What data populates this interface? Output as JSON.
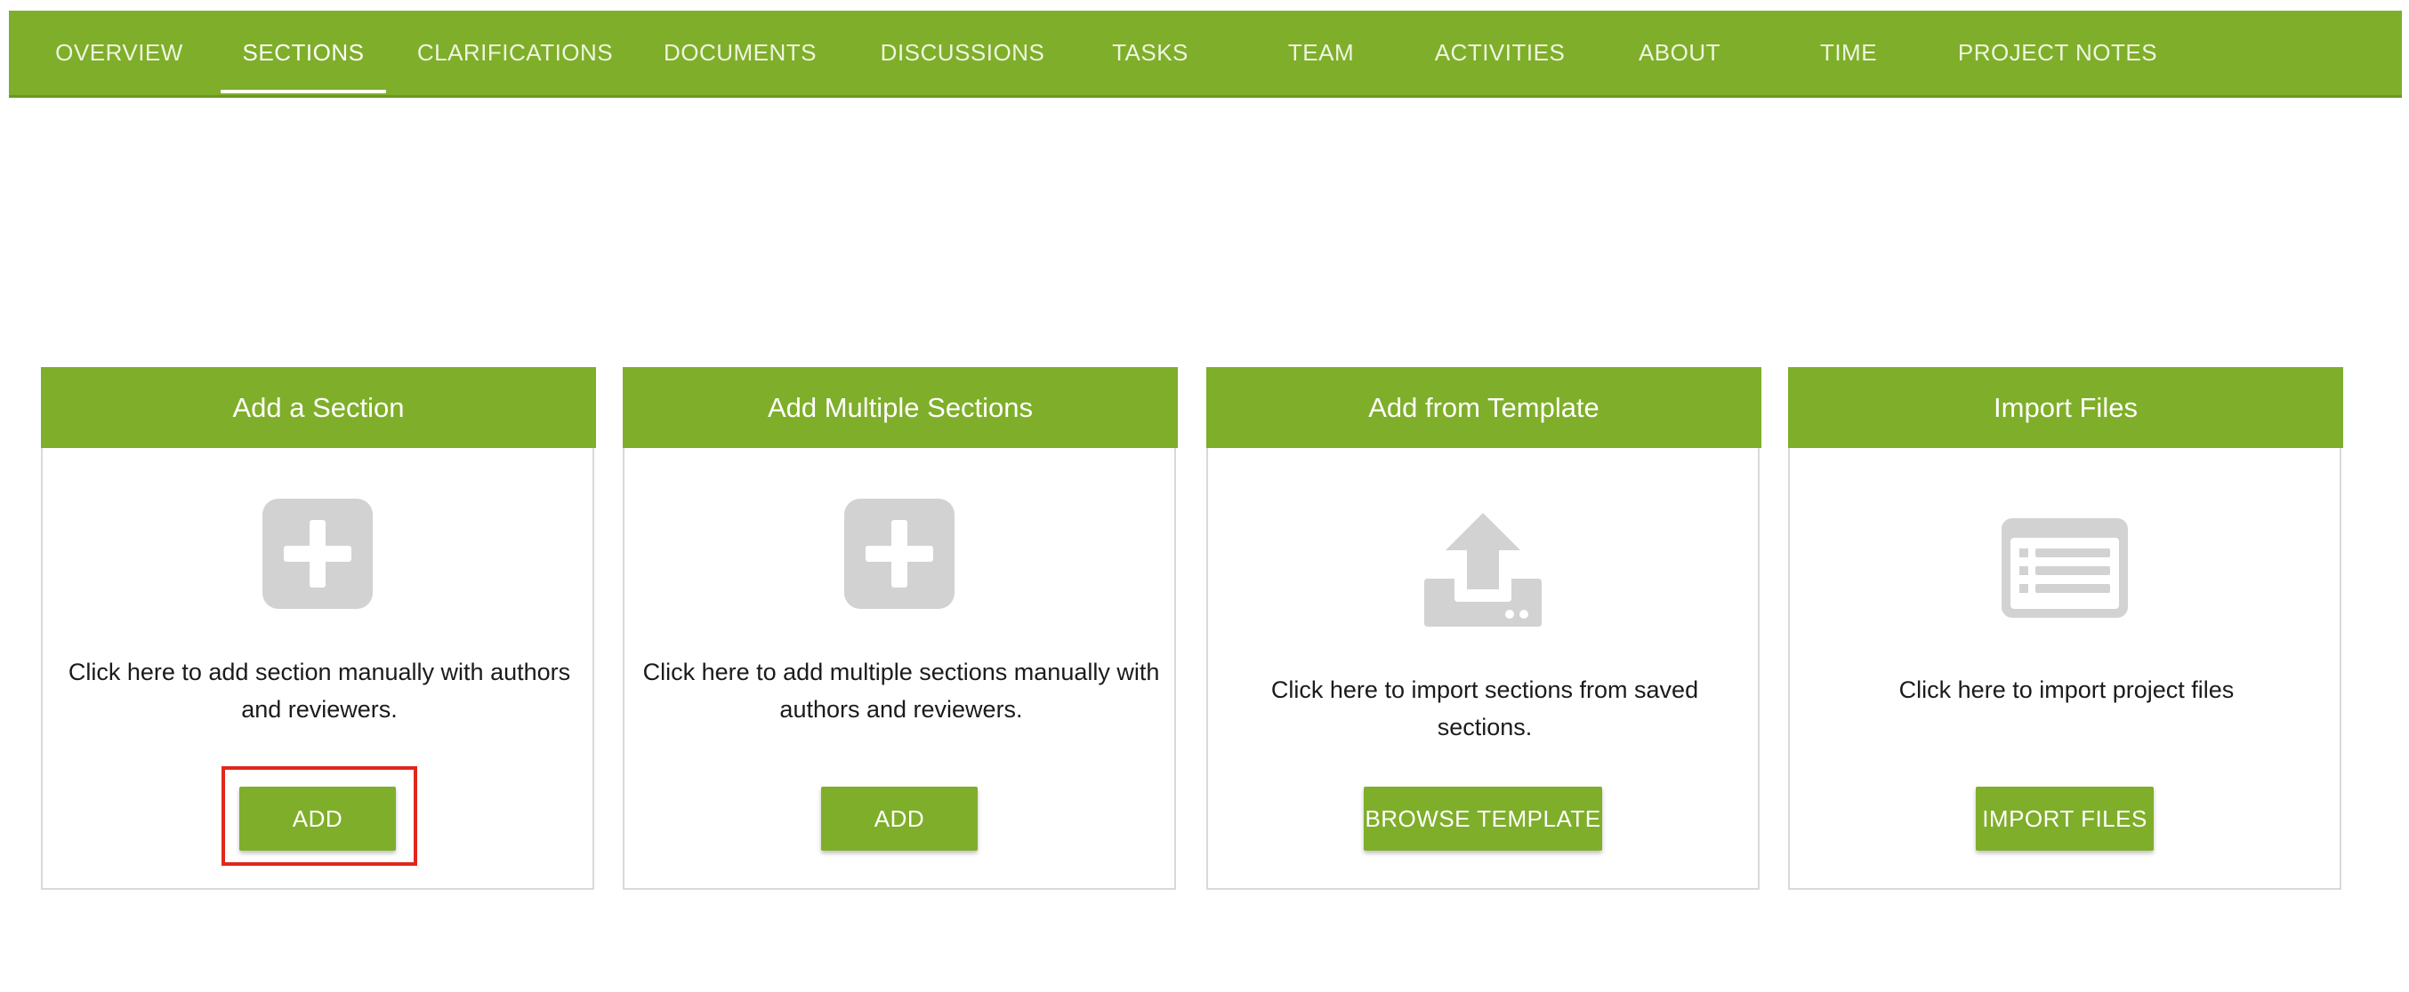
{
  "nav": {
    "tabs": [
      {
        "label": "OVERVIEW",
        "active": false
      },
      {
        "label": "SECTIONS",
        "active": true
      },
      {
        "label": "CLARIFICATIONS",
        "active": false
      },
      {
        "label": "DOCUMENTS",
        "active": false
      },
      {
        "label": "DISCUSSIONS",
        "active": false
      },
      {
        "label": "TASKS",
        "active": false
      },
      {
        "label": "TEAM",
        "active": false
      },
      {
        "label": "ACTIVITIES",
        "active": false
      },
      {
        "label": "ABOUT",
        "active": false
      },
      {
        "label": "TIME",
        "active": false
      },
      {
        "label": "PROJECT NOTES",
        "active": false
      }
    ]
  },
  "cards": [
    {
      "title": "Add a Section",
      "icon": "plus-square-icon",
      "description": "Click here to add section manually with authors and reviewers.",
      "button": "ADD"
    },
    {
      "title": "Add Multiple Sections",
      "icon": "plus-square-icon",
      "description": "Click here to add multiple sections manually with authors and reviewers.",
      "button": "ADD"
    },
    {
      "title": "Add from Template",
      "icon": "upload-tray-icon",
      "description": "Click here to import sections from saved sections.",
      "button": "BROWSE TEMPLATE"
    },
    {
      "title": "Import Files",
      "icon": "file-list-icon",
      "description": "Click here to import project files",
      "button": "IMPORT FILES"
    }
  ],
  "colors": {
    "brand_green": "#7fae2a",
    "icon_gray": "#d2d2d2",
    "highlight_red": "#e0281e"
  }
}
